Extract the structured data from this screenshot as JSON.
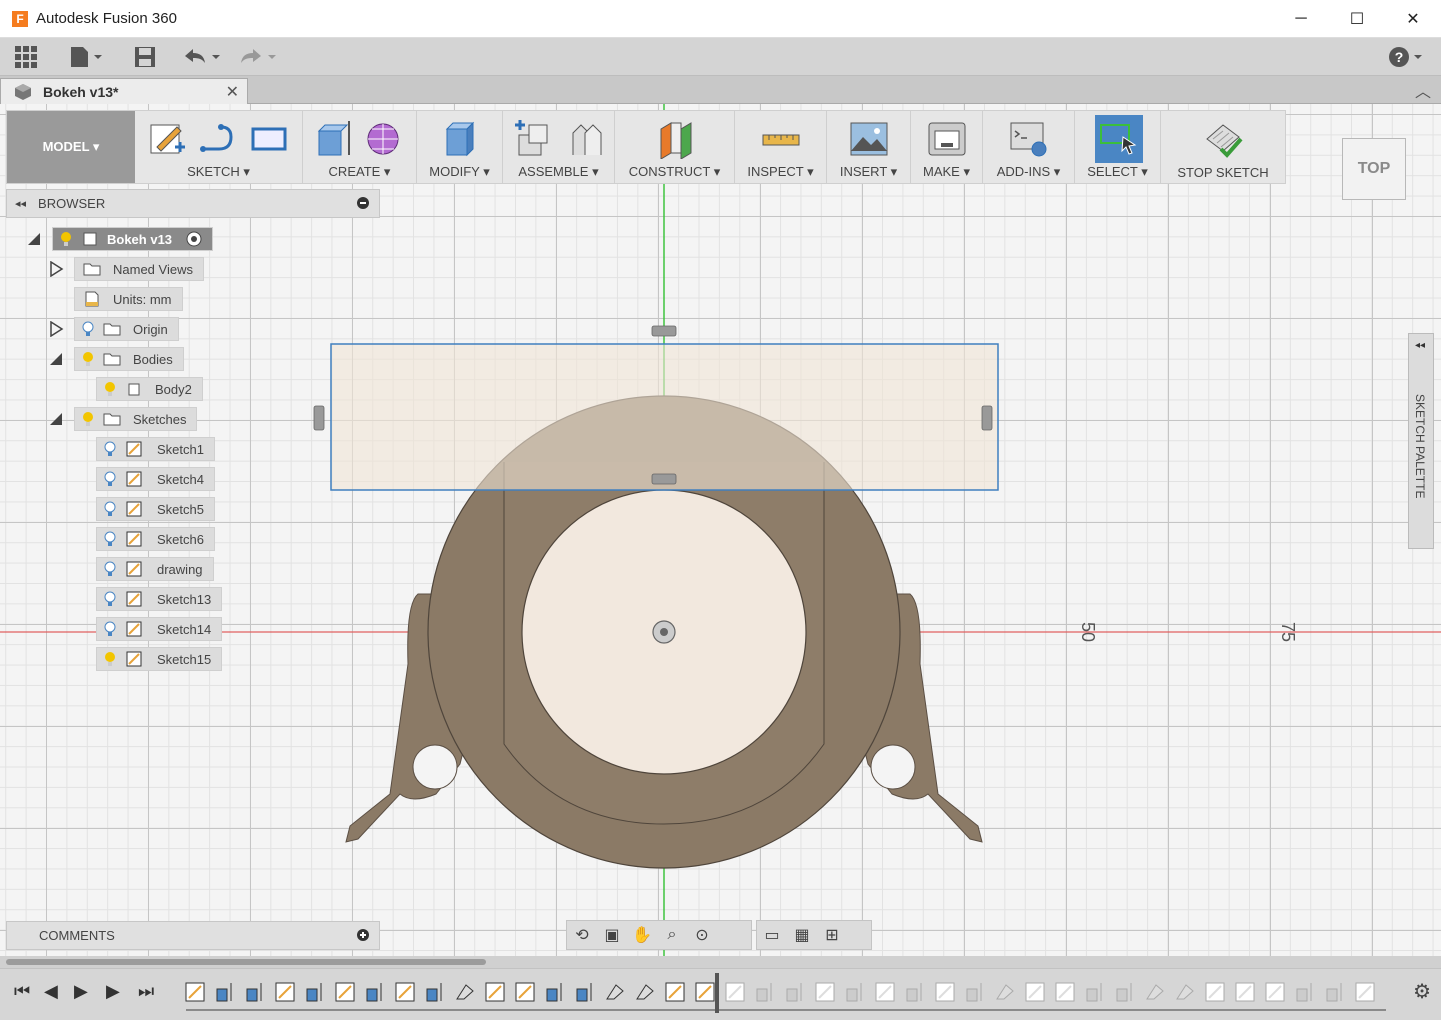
{
  "window": {
    "title": "Autodesk Fusion 360",
    "logo_letter": "F",
    "minimize": "─",
    "maximize": "☐",
    "close": "✕"
  },
  "doc_tab": {
    "label": "Bokeh v13*",
    "close": "✕"
  },
  "toolbar": {
    "workspace": "MODEL ▾",
    "groups": [
      "SKETCH ▾",
      "CREATE ▾",
      "MODIFY ▾",
      "ASSEMBLE ▾",
      "CONSTRUCT ▾",
      "INSPECT ▾",
      "INSERT ▾",
      "MAKE ▾",
      "ADD-INS ▾",
      "SELECT ▾",
      "STOP SKETCH"
    ]
  },
  "browser": {
    "title": "BROWSER",
    "root": "Bokeh v13",
    "items": [
      "Named Views",
      "Units: mm",
      "Origin",
      "Bodies",
      "Body2",
      "Sketches",
      "Sketch1",
      "Sketch4",
      "Sketch5",
      "Sketch6",
      "drawing",
      "Sketch13",
      "Sketch14",
      "Sketch15"
    ]
  },
  "comments": {
    "title": "COMMENTS"
  },
  "viewcube": {
    "label": "TOP"
  },
  "sketch_palette": {
    "label": "SKETCH PALETTE"
  },
  "dimensions": {
    "d50": "50",
    "d75": "75"
  },
  "colors": {
    "accent_select": "#3f7fbf",
    "body_fill": "#8b7a66",
    "sketch_rect": "#f0e4d6",
    "x_axis": "#e06060",
    "y_axis": "#40c040"
  }
}
